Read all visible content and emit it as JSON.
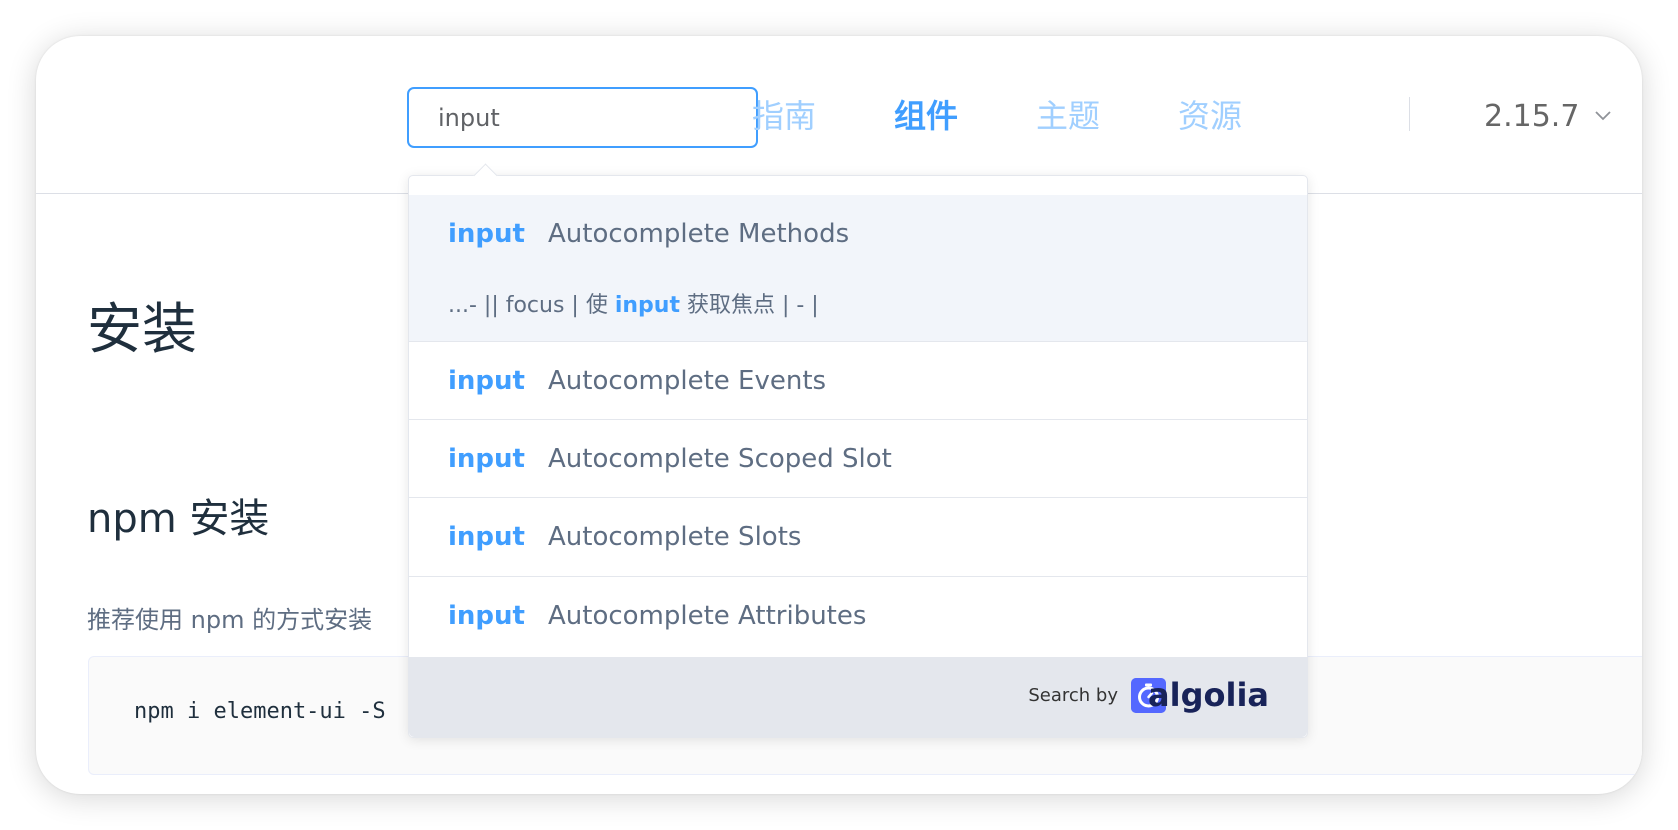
{
  "header": {
    "search": {
      "value": "input",
      "placeholder": ""
    },
    "nav": [
      {
        "label": "指南"
      },
      {
        "label": "组件"
      },
      {
        "label": "主题"
      },
      {
        "label": "资源"
      }
    ],
    "version": "2.15.7",
    "version_icon": "chevron-down-icon"
  },
  "content": {
    "h1": "安装",
    "h2": "npm 安装",
    "paragraph": "推荐使用 npm 的方式安装",
    "code": "npm i element-ui -S"
  },
  "dropdown": {
    "results": [
      {
        "hit": "input",
        "title": "Autocomplete Methods",
        "snippet_pre": "...- || focus | 使 ",
        "snippet_hit": "input",
        "snippet_post": " 获取焦点 | - |"
      },
      {
        "hit": "input",
        "title": "Autocomplete Events"
      },
      {
        "hit": "input",
        "title": "Autocomplete Scoped Slot"
      },
      {
        "hit": "input",
        "title": "Autocomplete Slots"
      },
      {
        "hit": "input",
        "title": "Autocomplete Attributes"
      }
    ],
    "footer": {
      "search_by": "Search by",
      "brand": "algolia",
      "brand_icon": "algolia-stopwatch-icon"
    }
  },
  "colors": {
    "accent": "#409eff",
    "nav_inactive": "#a0cfff",
    "highlight_bg": "#f2f5fa",
    "footer_bg": "#e4e7ed",
    "algolia_blue": "#5468ff"
  }
}
